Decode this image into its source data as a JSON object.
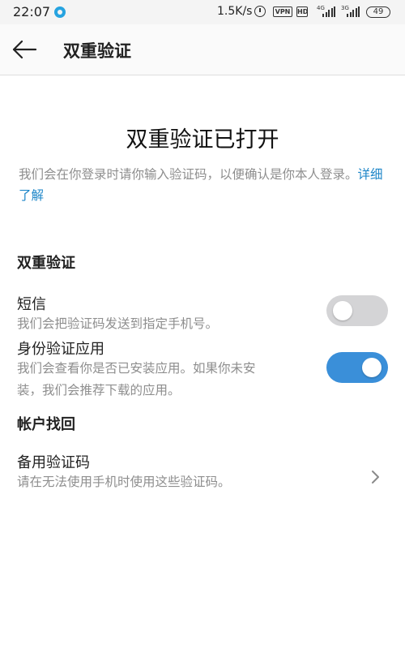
{
  "status_bar": {
    "time": "22:07",
    "net_speed": "1.5K/s",
    "vpn": "VPN",
    "hd": "HD",
    "net1": "4G",
    "net2": "3G",
    "battery": "49"
  },
  "header": {
    "title": "双重验证"
  },
  "main": {
    "heading": "双重验证已打开",
    "description": "我们会在你登录时请你输入验证码，以便确认是你本人登录。",
    "learn_more": "详细了解"
  },
  "sections": {
    "two_factor": {
      "title": "双重验证",
      "sms": {
        "label": "短信",
        "description": "我们会把验证码发送到指定手机号。",
        "enabled": false
      },
      "auth_app": {
        "label": "身份验证应用",
        "description_line1": "我们会查看你是否已安装应用。如果你未安",
        "description_line2": "装，我们会推荐下载的应用。",
        "enabled": true
      }
    },
    "recovery": {
      "title": "帐户找回",
      "backup_codes": {
        "label": "备用验证码",
        "description": "请在无法使用手机时使用这些验证码。"
      }
    }
  },
  "colors": {
    "accent": "#3a8fd9",
    "link": "#1d86c8",
    "toggle_off": "#d4d4d6",
    "secondary_text": "#8e8e8e"
  }
}
